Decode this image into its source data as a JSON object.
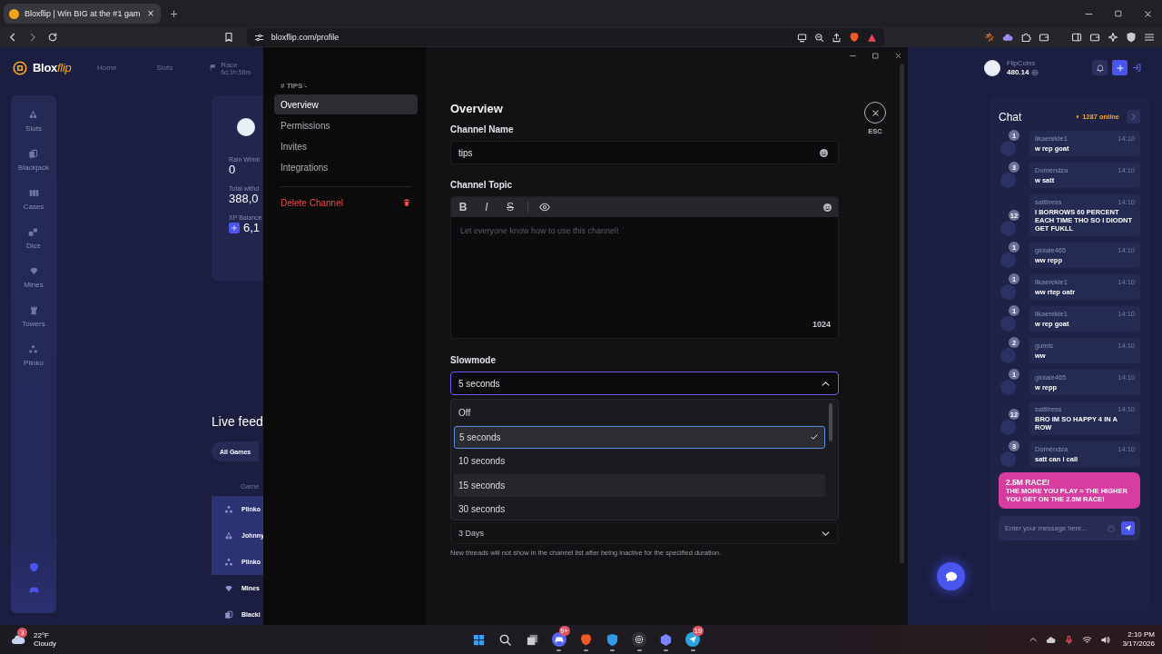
{
  "browser": {
    "tab": {
      "title": "Bloxflip | Win BIG at the #1 gam",
      "close": "×"
    },
    "new_tab": "+",
    "url": "bloxflip.com/profile"
  },
  "site": {
    "logo": {
      "text": "Blox",
      "accent": "flip"
    },
    "nav": [
      {
        "label": "Home"
      },
      {
        "label": "Slots"
      }
    ],
    "race": {
      "label": "Race",
      "timer": "6d:3h:58m"
    },
    "sidebar": [
      {
        "label": "Slots",
        "kind": "cherries"
      },
      {
        "label": "Blackjack",
        "kind": "cards"
      },
      {
        "label": "Cases",
        "kind": "cases"
      },
      {
        "label": "Dice",
        "kind": "dice"
      },
      {
        "label": "Mines",
        "kind": "diamond"
      },
      {
        "label": "Towers",
        "kind": "tower"
      },
      {
        "label": "Plinko",
        "kind": "plinko"
      }
    ],
    "profile": {
      "stats": [
        {
          "label": "Rain Winni",
          "value": "0"
        },
        {
          "label": "Total withd",
          "value": "388,0"
        },
        {
          "label": "XP Balance",
          "value": "6,1"
        }
      ]
    },
    "live_feed": {
      "title": "Live feed",
      "filter": "All Games",
      "column": "Game",
      "rows": [
        {
          "game": "Plinko",
          "kind": "plinko",
          "highlighted": true
        },
        {
          "game": "Johnny",
          "kind": "cherries",
          "highlighted": true
        },
        {
          "game": "Plinko",
          "kind": "plinko",
          "highlighted": true
        },
        {
          "game": "Mines",
          "kind": "diamond",
          "highlighted": false
        },
        {
          "game": "Blacki",
          "kind": "cards",
          "highlighted": false
        }
      ]
    },
    "wallet": {
      "label": "FlipCoins",
      "balance": "480.14"
    },
    "chat": {
      "title": "Chat",
      "online": "1287 online",
      "messages": [
        {
          "user": "likaerekle1",
          "level": "1",
          "time": "14:10",
          "text": "w rep goat"
        },
        {
          "user": "Domendza",
          "level": "3",
          "time": "14:10",
          "text": "w satt"
        },
        {
          "user": "sattiiress",
          "level": "12",
          "time": "14:10",
          "text": "I BORROWS 60 PERCENT EACH TIME THO SO I DIODNT GET FUKLL"
        },
        {
          "user": "giolaie465",
          "level": "1",
          "time": "14:10",
          "text": "ww repp"
        },
        {
          "user": "likaerekle1",
          "level": "1",
          "time": "14:10",
          "text": "ww rtep oatr"
        },
        {
          "user": "likaerekle1",
          "level": "1",
          "time": "14:10",
          "text": "w rep goat"
        },
        {
          "user": "gumis",
          "level": "2",
          "time": "14:10",
          "text": "ww"
        },
        {
          "user": "giolaie465",
          "level": "1",
          "time": "14:10",
          "text": "w repp"
        },
        {
          "user": "sattiiress",
          "level": "12",
          "time": "14:10",
          "text": "BRO IM SO HAPPY 4 IN A ROW"
        },
        {
          "user": "Domendza",
          "level": "3",
          "time": "14:10",
          "text": "satt can i call"
        }
      ],
      "banner": {
        "title": "2.5M RACE!",
        "text": "THE MORE YOU PLAY = THE HIGHER YOU GET ON THE 2.5M RACE!"
      },
      "input": {
        "placeholder": "Enter your message here..."
      }
    }
  },
  "settings": {
    "channel": "# TIPS -",
    "nav": [
      {
        "label": "Overview",
        "selected": true
      },
      {
        "label": "Permissions",
        "selected": false
      },
      {
        "label": "Invites",
        "selected": false
      },
      {
        "label": "Integrations",
        "selected": false
      }
    ],
    "delete": "Delete Channel",
    "heading": "Overview",
    "name_label": "Channel Name",
    "name_value": "tips",
    "topic_label": "Channel Topic",
    "toolbar": [
      {
        "label": "B",
        "kind": "bold"
      },
      {
        "label": "I",
        "kind": "italic"
      },
      {
        "label": "S",
        "kind": "strike"
      }
    ],
    "topic_placeholder": "Let everyone know how to use this channel!",
    "topic_counter": "1024",
    "slowmode": {
      "label": "Slowmode",
      "value": "5 seconds",
      "expanded": true,
      "options": [
        {
          "label": "Off",
          "selected": false,
          "hovered": false
        },
        {
          "label": "5 seconds",
          "selected": true,
          "hovered": false
        },
        {
          "label": "10 seconds",
          "selected": false,
          "hovered": false
        },
        {
          "label": "15 seconds",
          "selected": false,
          "hovered": true
        },
        {
          "label": "30 seconds",
          "selected": false,
          "hovered": false
        }
      ]
    },
    "hide_after": {
      "value": "3 Days",
      "hint": "New threads will not show in the channel list after being inactive for the specified duration."
    },
    "close_hint": "ESC"
  },
  "taskbar": {
    "weather": {
      "badge": "3",
      "temp": "22°F",
      "condition": "Cloudy"
    },
    "apps": [
      {
        "kind": "windows",
        "running": false
      },
      {
        "kind": "search",
        "running": false
      },
      {
        "kind": "taskview",
        "running": false
      },
      {
        "kind": "chat",
        "badge": "9+",
        "running": true
      },
      {
        "kind": "lion",
        "running": true
      },
      {
        "kind": "shield",
        "running": true
      },
      {
        "kind": "ring",
        "running": true
      },
      {
        "kind": "hexagon",
        "running": true
      },
      {
        "kind": "plane",
        "badge": "19",
        "running": true
      }
    ],
    "time": "2:10 PM",
    "date": "3/17/2026"
  }
}
